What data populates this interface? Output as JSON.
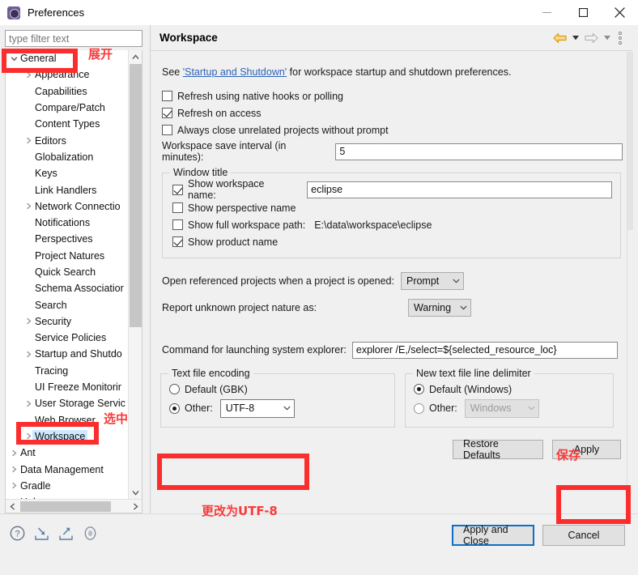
{
  "window": {
    "title": "Preferences",
    "icon": "preferences-gear-icon",
    "controls": {
      "minimize": "minimize-icon",
      "maximize": "maximize-icon",
      "close": "close-icon"
    }
  },
  "sidebar": {
    "filter": {
      "placeholder": "type filter text",
      "value": ""
    },
    "items": [
      {
        "label": "General",
        "level": 0,
        "expander": "down",
        "selected": false
      },
      {
        "label": "Appearance",
        "level": 1,
        "expander": "right",
        "selected": false
      },
      {
        "label": "Capabilities",
        "level": 1,
        "expander": "none",
        "selected": false
      },
      {
        "label": "Compare/Patch",
        "level": 1,
        "expander": "none",
        "selected": false
      },
      {
        "label": "Content Types",
        "level": 1,
        "expander": "none",
        "selected": false
      },
      {
        "label": "Editors",
        "level": 1,
        "expander": "right",
        "selected": false
      },
      {
        "label": "Globalization",
        "level": 1,
        "expander": "none",
        "selected": false
      },
      {
        "label": "Keys",
        "level": 1,
        "expander": "none",
        "selected": false
      },
      {
        "label": "Link Handlers",
        "level": 1,
        "expander": "none",
        "selected": false
      },
      {
        "label": "Network Connectio",
        "level": 1,
        "expander": "right",
        "selected": false
      },
      {
        "label": "Notifications",
        "level": 1,
        "expander": "none",
        "selected": false
      },
      {
        "label": "Perspectives",
        "level": 1,
        "expander": "none",
        "selected": false
      },
      {
        "label": "Project Natures",
        "level": 1,
        "expander": "none",
        "selected": false
      },
      {
        "label": "Quick Search",
        "level": 1,
        "expander": "none",
        "selected": false
      },
      {
        "label": "Schema Associatior",
        "level": 1,
        "expander": "none",
        "selected": false
      },
      {
        "label": "Search",
        "level": 1,
        "expander": "none",
        "selected": false
      },
      {
        "label": "Security",
        "level": 1,
        "expander": "right",
        "selected": false
      },
      {
        "label": "Service Policies",
        "level": 1,
        "expander": "none",
        "selected": false
      },
      {
        "label": "Startup and Shutdo",
        "level": 1,
        "expander": "right",
        "selected": false
      },
      {
        "label": "Tracing",
        "level": 1,
        "expander": "none",
        "selected": false
      },
      {
        "label": "UI Freeze Monitorir",
        "level": 1,
        "expander": "none",
        "selected": false
      },
      {
        "label": "User Storage Servic",
        "level": 1,
        "expander": "right",
        "selected": false
      },
      {
        "label": "Web Browser",
        "level": 1,
        "expander": "none",
        "selected": false
      },
      {
        "label": "Workspace",
        "level": 1,
        "expander": "right",
        "selected": true
      },
      {
        "label": "Ant",
        "level": 0,
        "expander": "right",
        "selected": false
      },
      {
        "label": "Data Management",
        "level": 0,
        "expander": "right",
        "selected": false
      },
      {
        "label": "Gradle",
        "level": 0,
        "expander": "right",
        "selected": false
      },
      {
        "label": "Help",
        "level": 0,
        "expander": "right",
        "selected": false
      }
    ]
  },
  "panel": {
    "title": "Workspace",
    "nav": {
      "back": "back-arrow-icon",
      "forward": "forward-arrow-icon",
      "menu": "view-menu-icon"
    },
    "see_prefix": "See ",
    "see_link": "'Startup and Shutdown'",
    "see_suffix": " for workspace startup and shutdown preferences.",
    "checkboxes": [
      {
        "label": "Refresh using native hooks or polling",
        "checked": false
      },
      {
        "label": "Refresh on access",
        "checked": true
      },
      {
        "label": "Always close unrelated projects without prompt",
        "checked": false
      }
    ],
    "save_interval": {
      "label": "Workspace save interval (in minutes):",
      "value": "5"
    },
    "window_title_group": {
      "legend": "Window title",
      "show_workspace_name": {
        "label": "Show workspace name:",
        "checked": true,
        "value": "eclipse"
      },
      "show_perspective_name": {
        "label": "Show perspective name",
        "checked": false
      },
      "show_full_workspace_path": {
        "label": "Show full workspace path:",
        "checked": false,
        "value": "E:\\data\\workspace\\eclipse"
      },
      "show_product_name": {
        "label": "Show product name",
        "checked": true
      }
    },
    "open_referenced": {
      "label": "Open referenced projects when a project is opened:",
      "value": "Prompt"
    },
    "report_unknown": {
      "label": "Report unknown project nature as:",
      "value": "Warning"
    },
    "command_explorer": {
      "label": "Command for launching system explorer:",
      "value": "explorer /E,/select=${selected_resource_loc}"
    },
    "encoding_group": {
      "legend": "Text file encoding",
      "default_label": "Default (GBK)",
      "default_selected": false,
      "other_label": "Other:",
      "other_selected": true,
      "other_value": "UTF-8"
    },
    "delimiter_group": {
      "legend": "New text file line delimiter",
      "default_label": "Default (Windows)",
      "default_selected": true,
      "other_label": "Other:",
      "other_selected": false,
      "other_value": "Windows"
    },
    "restore_defaults_label": "Restore Defaults",
    "apply_label": "Apply"
  },
  "footer": {
    "icons": [
      {
        "name": "help-icon"
      },
      {
        "name": "import-icon"
      },
      {
        "name": "export-icon"
      },
      {
        "name": "resize-grip-icon"
      }
    ],
    "apply_and_close_label": "Apply and Close",
    "cancel_label": "Cancel"
  },
  "annotations": [
    {
      "name": "annotation-expand",
      "text": "展开"
    },
    {
      "name": "annotation-selected",
      "text": "选中"
    },
    {
      "name": "annotation-save",
      "text": "保存"
    },
    {
      "name": "annotation-utf8",
      "text": "更改为UTF-8"
    }
  ],
  "colors": {
    "annotation_red": "#fc2d2d",
    "selection_blue": "#cde8ff",
    "link_blue": "#2e63b8",
    "primary_border": "#0f6fc6",
    "nav_back_gold": "#e8a317"
  }
}
